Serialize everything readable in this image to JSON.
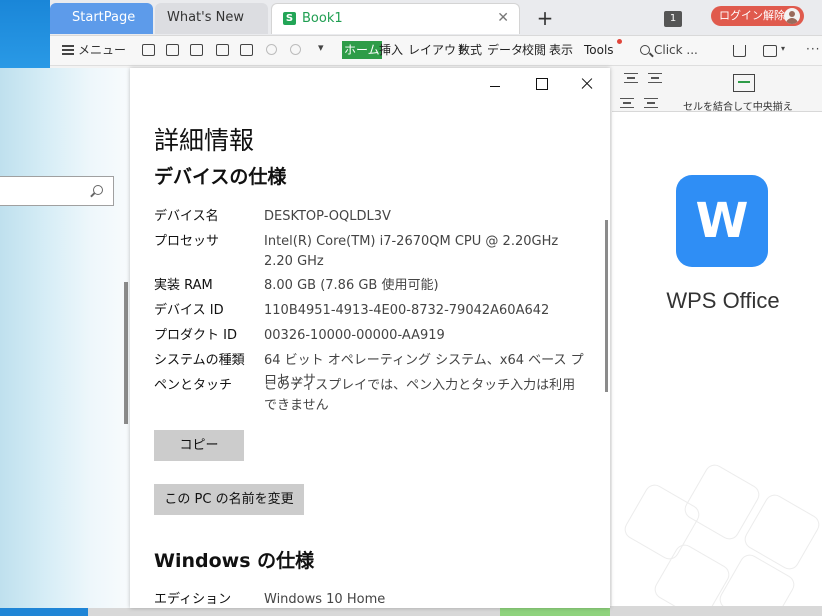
{
  "wps": {
    "tabs": [
      {
        "label": "StartPage"
      },
      {
        "label": "What's New"
      },
      {
        "label": "Book1"
      }
    ],
    "tab_add": "+",
    "tab_close": "✕",
    "window_count": "1",
    "login_label": "ログイン解除",
    "toolbar": {
      "menu_label": "メニュー",
      "ribbon_tabs": [
        "ホーム",
        "挿入",
        "レイアウト",
        "数式",
        "データ",
        "校閲",
        "表示",
        "Tools"
      ],
      "search_label": "Click ...",
      "more": "···"
    },
    "ribbon": {
      "merge_label": "セルを結合して中央揃え"
    },
    "panel": {
      "logo_letter": "W",
      "product_name": "WPS Office"
    },
    "colors": {
      "start_tab": "#5d9bea",
      "home_tab": "#2e9c48",
      "login": "#e05a4d",
      "wps_logo": "#2f8ef5"
    }
  },
  "about": {
    "title": "詳細情報",
    "device_section": "デバイスの仕様",
    "specs": [
      {
        "label": "デバイス名",
        "value": "DESKTOP-OQLDL3V"
      },
      {
        "label": "プロセッサ",
        "value": "Intel(R) Core(TM) i7-2670QM CPU @ 2.20GHz   2.20 GHz"
      },
      {
        "label": "実装 RAM",
        "value": "8.00 GB (7.86 GB 使用可能)"
      },
      {
        "label": "デバイス ID",
        "value": "110B4951-4913-4E00-8732-79042A60A642"
      },
      {
        "label": "プロダクト ID",
        "value": "00326-10000-00000-AA919"
      },
      {
        "label": "システムの種類",
        "value": "64 ビット オペレーティング システム、x64 ベース プロセッサ"
      },
      {
        "label": "ペンとタッチ",
        "value": "このディスプレイでは、ペン入力とタッチ入力は利用できません"
      }
    ],
    "copy_button": "コピー",
    "rename_button": "この PC の名前を変更",
    "windows_section": "Windows の仕様",
    "windows_specs": [
      {
        "label": "エディション",
        "value": "Windows 10 Home"
      }
    ]
  }
}
